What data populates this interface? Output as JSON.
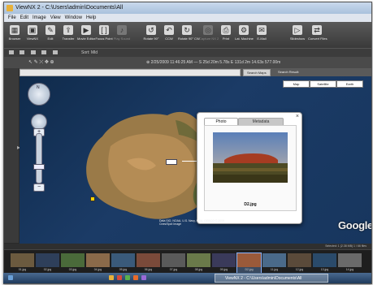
{
  "window": {
    "title": "ViewNX 2 - C:\\Users\\admin\\Documents\\All"
  },
  "menu": [
    "File",
    "Edit",
    "Image",
    "View",
    "Window",
    "Help"
  ],
  "toolbar": [
    {
      "label": "Browser",
      "icon": "browser-icon"
    },
    {
      "label": "ViewNX",
      "icon": "view-icon"
    },
    {
      "label": "Edit",
      "icon": "edit-icon"
    },
    {
      "label": "Transfer",
      "icon": "transfer-icon"
    },
    {
      "label": "Movie Editor",
      "icon": "movie-icon"
    },
    {
      "label": "Focus Point",
      "icon": "focus-icon"
    },
    {
      "label": "Play Sound",
      "icon": "sound-icon",
      "disabled": true
    },
    {
      "label": "Rotate 90°",
      "icon": "rotate-left-icon"
    },
    {
      "label": "CCW",
      "icon": "rotate-ccw-icon"
    },
    {
      "label": "Rotate 90° CW",
      "icon": "rotate-right-icon"
    },
    {
      "label": "Capture NX 2",
      "icon": "capture-icon",
      "disabled": true
    },
    {
      "label": "Print",
      "icon": "print-icon"
    },
    {
      "label": "Lat. Machine",
      "icon": "machine-icon"
    },
    {
      "label": "E-Mail",
      "icon": "mail-icon"
    },
    {
      "label": "Slideshow",
      "icon": "slideshow-icon"
    },
    {
      "label": "Convert Files",
      "icon": "convert-icon"
    }
  ],
  "toolbar2": {
    "sort_label": "Sort: Mld"
  },
  "location_bar": {
    "datetime": "2/25/2009 11:46:25 AM",
    "coords": "S 25d 20m 5.78s  E 131d 2m 14.63s  577.00m"
  },
  "map": {
    "search_button": "Search Maps",
    "search_result": "Search Result:",
    "types": [
      "Map",
      "Satellite",
      "Earth"
    ],
    "attribution": "Data SIO, NOAA, U.S. Navy, NGA, GEBCO © 2009 Cnes/Spot Image",
    "logo": "Google"
  },
  "popup": {
    "tabs": [
      "Photo",
      "Metadata"
    ],
    "filename": "D2.jpg",
    "close": "×"
  },
  "status": {
    "right_text": "Selected: 1 (2.38 MB)  1 / 66 files"
  },
  "filmstrip": [
    {
      "label": "01.jpg",
      "color": "#6b5a3f"
    },
    {
      "label": "02.jpg",
      "color": "#2e3f5a"
    },
    {
      "label": "03.jpg",
      "color": "#4a6a3a"
    },
    {
      "label": "04.jpg",
      "color": "#8a6a4a"
    },
    {
      "label": "05.jpg",
      "color": "#3a5a7a"
    },
    {
      "label": "06.jpg",
      "color": "#7a4a3a"
    },
    {
      "label": "07.jpg",
      "color": "#5a5a5a"
    },
    {
      "label": "08.jpg",
      "color": "#6a7a4a"
    },
    {
      "label": "09.jpg",
      "color": "#3a3a5a"
    },
    {
      "label": "D2.jpg",
      "color": "#9a5a3a",
      "selected": true
    },
    {
      "label": "11.jpg",
      "color": "#4a6a8a"
    },
    {
      "label": "12.jpg",
      "color": "#5a4a3a"
    },
    {
      "label": "13.jpg",
      "color": "#2a4a6a"
    },
    {
      "label": "14.jpg",
      "color": "#6a6a6a"
    }
  ],
  "taskbar": {
    "task_label": "ViewNX 2 - C:\\Users\\admin\\Documents\\All"
  }
}
